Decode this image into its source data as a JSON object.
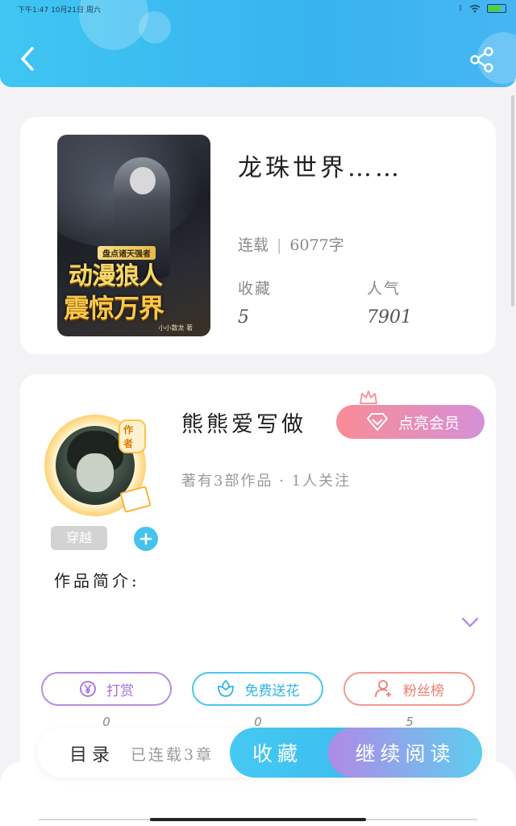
{
  "status_bar": {
    "time_date": "下午1:47  10月21日  周六"
  },
  "book": {
    "cover_tag": "盘点诸天强者",
    "cover_title_line1": "动漫狼人",
    "cover_title_line2": "震惊万界",
    "cover_author": "小小散龙 著",
    "title": "龙珠世界……",
    "status": "连载",
    "word_count": "6077字",
    "favorites_label": "收藏",
    "favorites_value": "5",
    "popularity_label": "人气",
    "popularity_value": "7901"
  },
  "author": {
    "badge": "作者",
    "name": "熊熊爱写做",
    "vip_button": "点亮会员",
    "works_info": "著有3部作品 · 1人关注",
    "genre_tag": "穿越",
    "intro_label": "作品简介:"
  },
  "actions": {
    "tip": {
      "label": "打赏",
      "count": "0"
    },
    "flower": {
      "label": "免费送花",
      "count": "0"
    },
    "fans": {
      "label": "粉丝榜",
      "count": "5"
    }
  },
  "toolbar": {
    "catalog": "目录",
    "chapters": "已连载3章",
    "favorite": "收藏",
    "continue_reading": "继续阅读"
  },
  "colors": {
    "header": "#38b3ef",
    "accent_blue": "#45c3ee",
    "vip_gradient_start": "#f98c95",
    "vip_gradient_end": "#d590d7",
    "tip_purple": "#b58ee0",
    "fans_coral": "#f29a8e"
  },
  "icons": [
    "back-icon",
    "share-icon",
    "crown-icon",
    "diamond-icon",
    "plus-icon",
    "chevron-down-icon",
    "yen-icon",
    "flower-icon",
    "fans-icon"
  ]
}
